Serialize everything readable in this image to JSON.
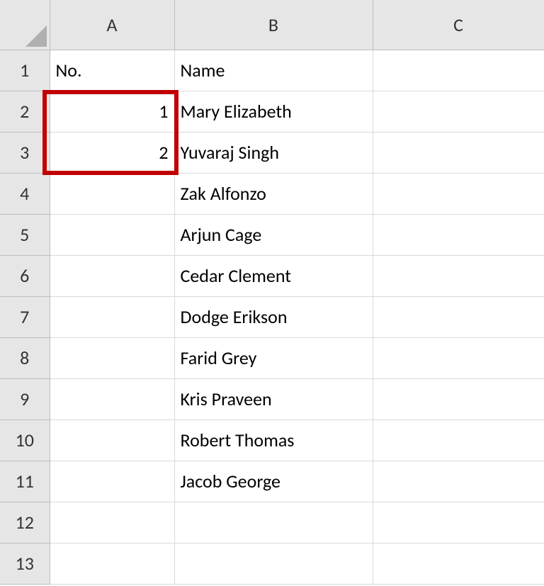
{
  "columns": {
    "A": "A",
    "B": "B",
    "C": "C"
  },
  "row_numbers": [
    "1",
    "2",
    "3",
    "4",
    "5",
    "6",
    "7",
    "8",
    "9",
    "10",
    "11",
    "12",
    "13"
  ],
  "chart_data": {
    "type": "table",
    "headers": {
      "no": "No.",
      "name": "Name"
    },
    "rows": [
      {
        "no": "1",
        "name": "Mary Elizabeth"
      },
      {
        "no": "2",
        "name": "Yuvaraj Singh"
      },
      {
        "no": "",
        "name": "Zak Alfonzo"
      },
      {
        "no": "",
        "name": "Arjun Cage"
      },
      {
        "no": "",
        "name": "Cedar Clement"
      },
      {
        "no": "",
        "name": "Dodge Erikson"
      },
      {
        "no": "",
        "name": "Farid Grey"
      },
      {
        "no": "",
        "name": "Kris Praveen"
      },
      {
        "no": "",
        "name": "Robert Thomas"
      },
      {
        "no": "",
        "name": "Jacob George"
      }
    ]
  },
  "highlight": {
    "cells": "A2:A3"
  }
}
